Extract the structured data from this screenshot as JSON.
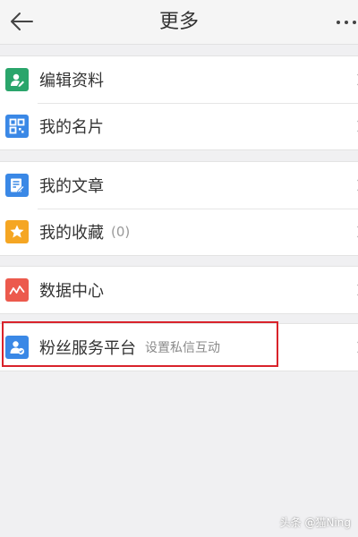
{
  "header": {
    "title": "更多"
  },
  "groups": [
    {
      "items": [
        {
          "label": "编辑资料",
          "icon": "profile-edit-icon",
          "color": "#2aa56b"
        },
        {
          "label": "我的名片",
          "icon": "qr-card-icon",
          "color": "#3a88e6"
        }
      ]
    },
    {
      "items": [
        {
          "label": "我的文章",
          "icon": "article-edit-icon",
          "color": "#3a88e6"
        },
        {
          "label": "我的收藏",
          "count": "(0)",
          "icon": "star-icon",
          "color": "#f5a623"
        }
      ]
    },
    {
      "items": [
        {
          "label": "数据中心",
          "icon": "chart-line-icon",
          "color": "#ec5a4d"
        }
      ]
    },
    {
      "items": [
        {
          "label": "粉丝服务平台",
          "sub": "设置私信互动",
          "icon": "fan-service-icon",
          "color": "#3a88e6"
        }
      ]
    }
  ],
  "watermark": "头条 @猫Ning"
}
